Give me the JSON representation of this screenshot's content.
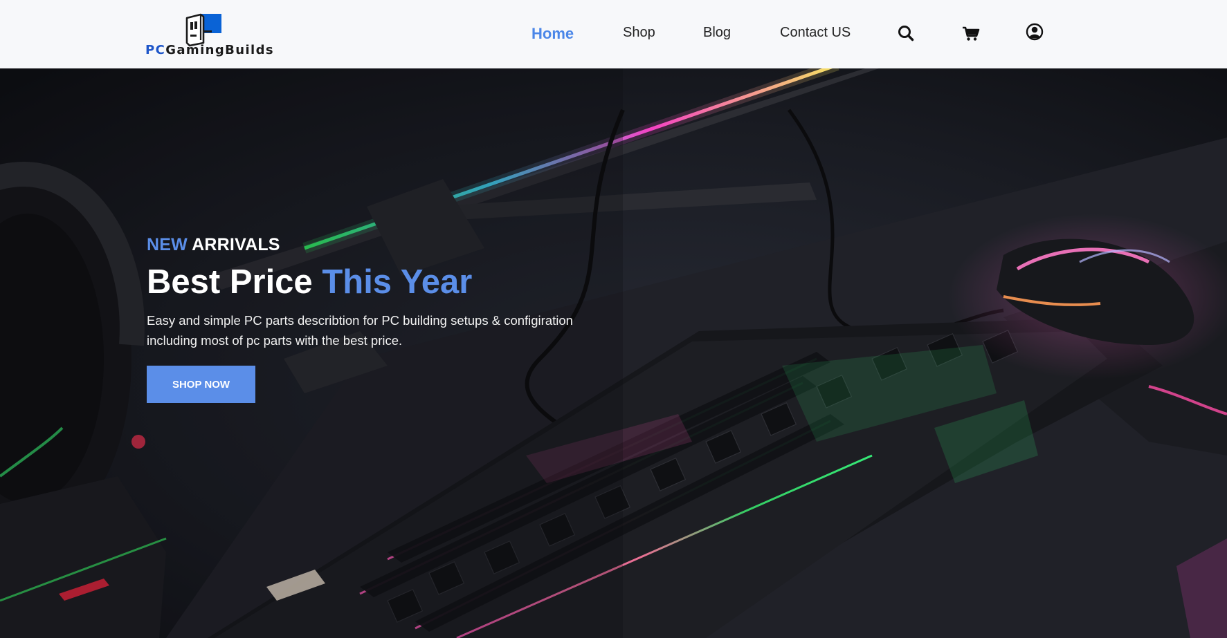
{
  "brand": {
    "prefix": "PC",
    "name": "GamingBuilds",
    "colors": {
      "prefix": "#1e56c9",
      "mark": "#0a63d6",
      "text": "#1b1b1b"
    },
    "logo_icon": "pc-tower-logo-icon"
  },
  "nav": {
    "items": [
      {
        "label": "Home",
        "active": true
      },
      {
        "label": "Shop",
        "active": false
      },
      {
        "label": "Blog",
        "active": false
      },
      {
        "label": "Contact US",
        "active": false
      }
    ],
    "icons": [
      "search-icon",
      "cart-icon",
      "user-account-icon"
    ],
    "active_color": "#4a86e8"
  },
  "hero": {
    "eyebrow_accent": "NEW",
    "eyebrow_rest": "ARRIVALS",
    "headline_main": "Best Price",
    "headline_accent": "This Year",
    "description_line1": "Easy and simple PC parts describtion for PC building setups & configiration",
    "description_line2": "including most of pc parts with the best price.",
    "cta_label": "SHOP NOW",
    "accent_color": "#5b8ee8",
    "background_image": "rgb-gaming-keyboard-mouse-desk-photo"
  }
}
